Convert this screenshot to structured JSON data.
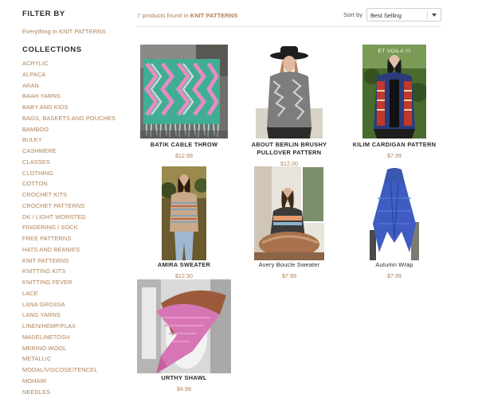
{
  "sidebar": {
    "filter_heading": "FILTER BY",
    "filter_link": "Everything in KNIT PATTERNS",
    "collections_heading": "COLLECTIONS",
    "collections": [
      "ACRYLIC",
      "ALPACA",
      "ARAN",
      "BAAH YARNS",
      "BABY AND KIDS",
      "BAGS, BASKETS AND POUCHES",
      "BAMBOO",
      "BULKY",
      "CASHMERE",
      "CLASSES",
      "CLOTHING",
      "COTTON",
      "CROCHET KITS",
      "CROCHET PATTERNS",
      "DK / LIGHT WORSTED",
      "FINGERING / SOCK",
      "FREE PATTERNS",
      "HATS AND BEANIES",
      "KNIT PATTERNS",
      "KNITTING KITS",
      "KNITTING FEVER",
      "LACE",
      "LANA GROSSA",
      "LANG YARNS",
      "LINEN/HEMP/FLAX",
      "MADELINETOSH",
      "MERINO WOOL",
      "METALLIC",
      "MODAL/VISCOSE/TENCEL",
      "MOHAIR",
      "NEEDLES"
    ]
  },
  "topbar": {
    "count_prefix": "7 products found in",
    "count_collection": "KNIT PATTERNS",
    "sort_label": "Sort by",
    "sort_value": "Best Selling"
  },
  "products": [
    {
      "name": "BATIK CABLE THROW",
      "price": "$12.99",
      "image_text": ""
    },
    {
      "name": "ABOUT BERLIN BRUSHY",
      "name2": "PULLOVER PATTERN",
      "price": "$12.00",
      "image_text": ""
    },
    {
      "name": "KILIM CARDIGAN PATTERN",
      "price": "$7.99",
      "image_text": "ET VOILA !!!"
    },
    {
      "name": "AMIRA SWEATER",
      "price": "$12.50",
      "image_text": ""
    },
    {
      "name": "Avery Boucle Sweater",
      "price": "$7.99",
      "image_text": ""
    },
    {
      "name": "Autumn Wrap",
      "price": "$7.99",
      "image_text": ""
    },
    {
      "name": "URTHY SHAWL",
      "price": "$4.99",
      "image_text": ""
    }
  ],
  "colors": {
    "accent": "#b08257",
    "heading": "#2a2a2a",
    "divider": "#e6e6e6"
  }
}
